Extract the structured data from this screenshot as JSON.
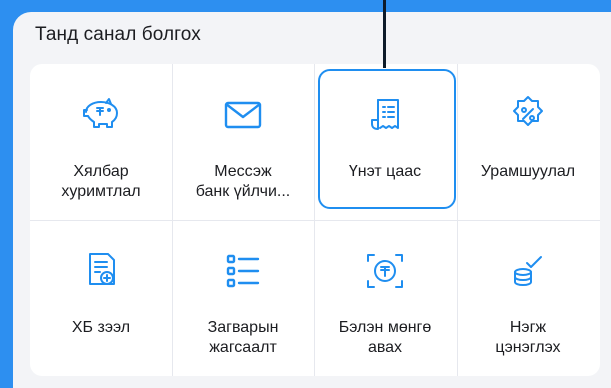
{
  "section": {
    "title": "Танд санал болгох"
  },
  "tiles": [
    {
      "label": "Хялбар\nхуримтлал",
      "icon": "piggy-bank-icon"
    },
    {
      "label": "Мессэж\nбанк үйлчи...",
      "icon": "envelope-icon"
    },
    {
      "label": "Үнэт цаас",
      "icon": "receipt-icon"
    },
    {
      "label": "Урамшуулал",
      "icon": "percent-badge-icon"
    },
    {
      "label": "ХБ зээл",
      "icon": "loan-document-icon"
    },
    {
      "label": "Загварын\nжагсаалт",
      "icon": "list-icon"
    },
    {
      "label": "Бэлэн мөнгө\nавах",
      "icon": "cash-withdraw-icon"
    },
    {
      "label": "Нэгж\nцэнэглэх",
      "icon": "coins-check-icon"
    }
  ],
  "colors": {
    "accent": "#1f8ef0",
    "background": "#2d8ff0",
    "panel": "#f3f4f7",
    "text": "#1c1d21"
  }
}
